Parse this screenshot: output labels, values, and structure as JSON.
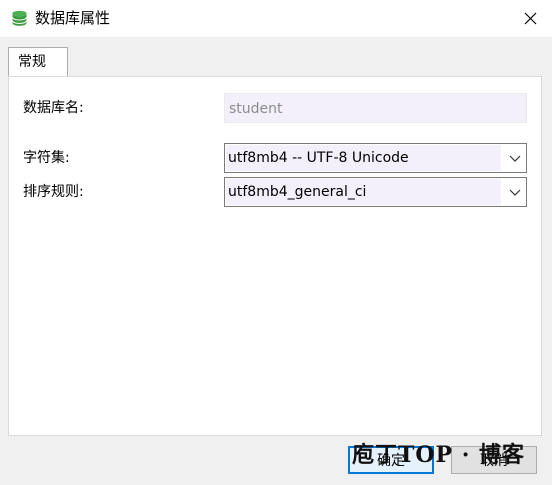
{
  "window": {
    "title": "数据库属性",
    "icon": "database-icon"
  },
  "tabs": [
    {
      "label": "常规",
      "active": true
    }
  ],
  "form": {
    "db_name": {
      "label": "数据库名:",
      "value": "student"
    },
    "charset": {
      "label": "字符集:",
      "value": "utf8mb4 -- UTF-8 Unicode"
    },
    "collation": {
      "label": "排序规则:",
      "value": "utf8mb4_general_ci"
    }
  },
  "buttons": {
    "ok": "确定",
    "cancel": "取消"
  },
  "watermark": "庖丁TOP · 博客",
  "colors": {
    "accent": "#0078d7",
    "field_bg": "#f3f0fb",
    "icon_green": "#4caf50"
  }
}
